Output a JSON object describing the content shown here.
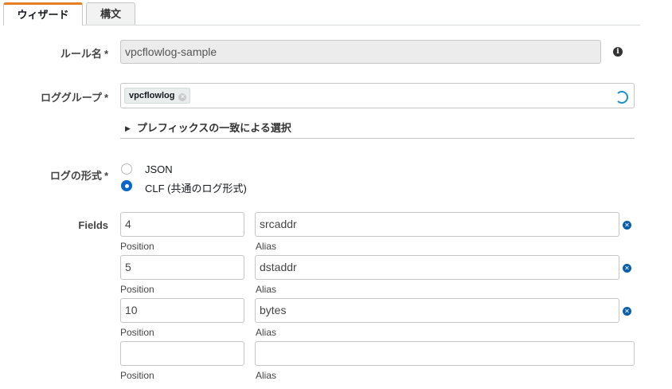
{
  "tabs": {
    "wizard": "ウィザード",
    "syntax": "構文"
  },
  "rule_name": {
    "label": "ルール名",
    "required": "*",
    "value": "vpcflowlog-sample",
    "info_icon": "info-icon"
  },
  "log_group": {
    "label": "ロググループ",
    "required": "*",
    "token": "vpcflowlog",
    "token_remove": "⊗",
    "loading_icon": "spinner-icon"
  },
  "prefix_select": {
    "caret": "▶",
    "label": "プレフィックスの一致による選択"
  },
  "log_format": {
    "label": "ログの形式",
    "required": "*",
    "options": [
      {
        "label": "JSON",
        "selected": false
      },
      {
        "label": "CLF (共通のログ形式)",
        "selected": true
      }
    ]
  },
  "fields": {
    "label": "Fields",
    "position_caption": "Position",
    "alias_caption": "Alias",
    "remove_glyph": "✕",
    "rows": [
      {
        "position": "4",
        "alias": "srcaddr",
        "removable": true
      },
      {
        "position": "5",
        "alias": "dstaddr",
        "removable": true
      },
      {
        "position": "10",
        "alias": "bytes",
        "removable": true
      },
      {
        "position": "",
        "alias": "",
        "removable": false
      }
    ]
  },
  "colors": {
    "accent_tab": "#e67e22",
    "radio_selected": "#0a66c9",
    "remove_icon": "#0b5fa8",
    "spinner": "#1b8fc9"
  }
}
